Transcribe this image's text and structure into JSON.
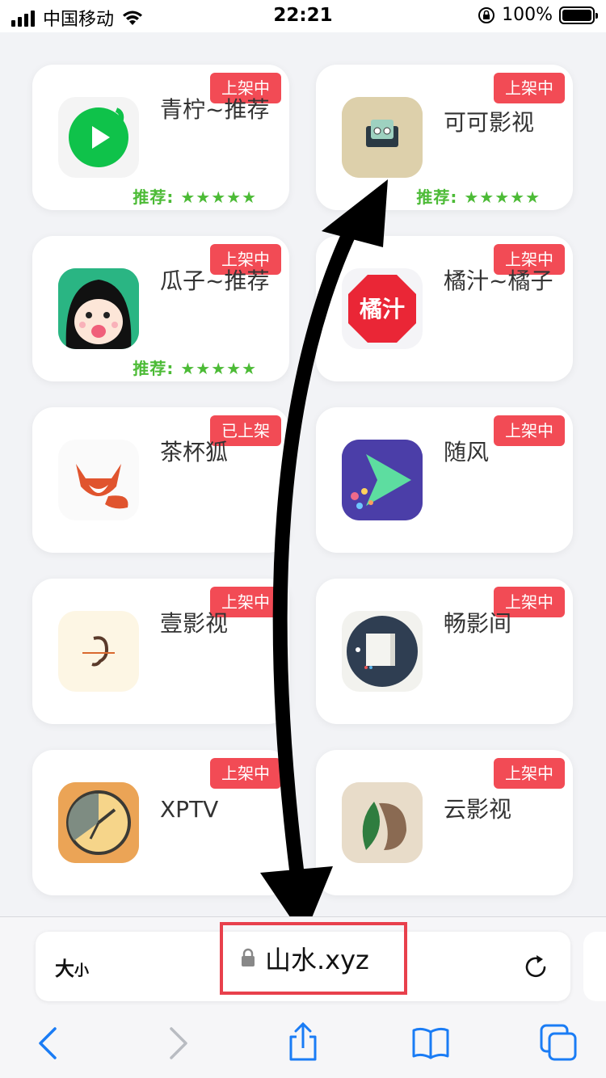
{
  "status_bar": {
    "carrier": "中国移动",
    "time": "22:21",
    "battery": "100%"
  },
  "apps": [
    {
      "name": "青柠~推荐",
      "badge": "上架中",
      "rating": "推荐: ★★★★★",
      "icon": "green-play-icon"
    },
    {
      "name": "可可影视",
      "badge": "上架中",
      "rating": "推荐: ★★★★★",
      "icon": "cartoon-tv-icon"
    },
    {
      "name": "瓜子~推荐",
      "badge": "上架中",
      "rating": "推荐: ★★★★★",
      "icon": "cartoon-girl-icon"
    },
    {
      "name": "橘汁~橘子",
      "badge": "上架中",
      "rating": "",
      "icon": "juzhi-logo-icon",
      "icon_text": "橘汁"
    },
    {
      "name": "茶杯狐",
      "badge": "已上架",
      "rating": "",
      "icon": "fox-icon"
    },
    {
      "name": "随风",
      "badge": "上架中",
      "rating": "",
      "icon": "play-arrow-icon"
    },
    {
      "name": "壹影视",
      "badge": "上架中",
      "rating": "",
      "icon": "ear-icon"
    },
    {
      "name": "畅影间",
      "badge": "上架中",
      "rating": "",
      "icon": "screen-circle-icon"
    },
    {
      "name": "XPTV",
      "badge": "上架中",
      "rating": "",
      "icon": "clock-icon"
    },
    {
      "name": "云影视",
      "badge": "上架中",
      "rating": "",
      "icon": "leaf-animal-icon"
    }
  ],
  "browser": {
    "text_size_big": "大",
    "text_size_small": "小",
    "url": "山水.xyz"
  },
  "colors": {
    "badge": "#f24b55",
    "rating": "#4cbb36",
    "highlight_box": "#e8404c",
    "toolbar_icon": "#1a7cf5"
  }
}
